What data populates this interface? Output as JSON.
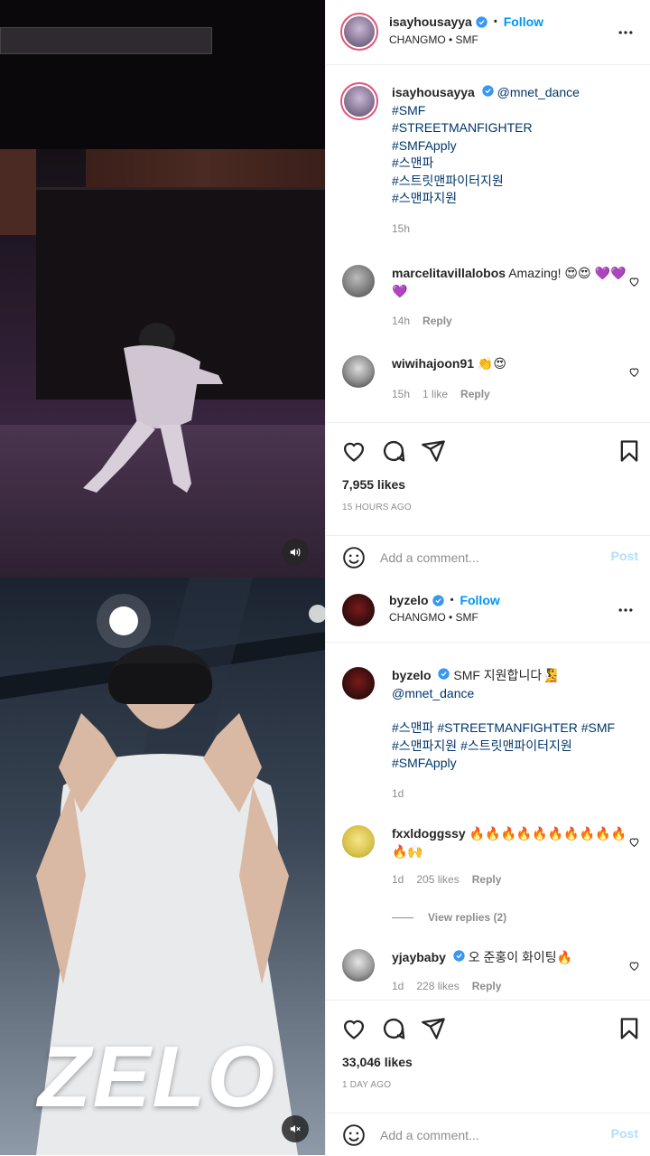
{
  "posts": [
    {
      "header": {
        "username": "isayhousayya",
        "follow": "Follow",
        "subtitle": "CHANGMO • SMF"
      },
      "caption": {
        "username": "isayhousayya",
        "mention": "@mnet_dance",
        "hashtags": [
          "#SMF",
          "#STREETMANFIGHTER",
          "#SMFApply",
          "#스맨파",
          "#스트릿맨파이터지원",
          "#스맨파지원"
        ],
        "time": "15h"
      },
      "comments": [
        {
          "username": "marcelitavillalobos",
          "text": "Amazing! 😍😍 💜💜💜",
          "time": "14h",
          "likes": "",
          "reply": "Reply"
        },
        {
          "username": "wiwihajoon91",
          "text": "👏😍",
          "time": "15h",
          "likes": "1 like",
          "reply": "Reply"
        }
      ],
      "likes": "7,955 likes",
      "time_ago": "15 HOURS AGO",
      "comment_placeholder": "Add a comment...",
      "post_label": "Post"
    },
    {
      "header": {
        "username": "byzelo",
        "follow": "Follow",
        "subtitle": "CHANGMO • SMF"
      },
      "caption": {
        "username": "byzelo",
        "text": "SMF 지원합니다🧏",
        "mention": "@mnet_dance",
        "hashtag_line1": "#스맨파 #STREETMANFIGHTER #SMF",
        "hashtag_line2": "#스맨파지원 #스트릿맨파이터지원",
        "hashtag_line3": "#SMFApply",
        "time": "1d"
      },
      "comments": [
        {
          "username": "fxxldoggssy",
          "text": "🔥🔥🔥🔥🔥🔥🔥🔥🔥🔥 🔥🙌",
          "time": "1d",
          "likes": "205 likes",
          "reply": "Reply",
          "view_replies": "View replies (2)"
        },
        {
          "username": "yjaybaby",
          "text": "오 준홍이 화이팅🔥",
          "time": "1d",
          "likes": "228 likes",
          "reply": "Reply"
        }
      ],
      "likes": "33,046 likes",
      "time_ago": "1 DAY AGO",
      "comment_placeholder": "Add a comment...",
      "post_label": "Post",
      "overlay_text": "ZELO"
    }
  ],
  "colors": {
    "accent": "#0095f6",
    "hashtag": "#00376b",
    "muted": "#8e8e8e",
    "ring": "#e0557a"
  }
}
